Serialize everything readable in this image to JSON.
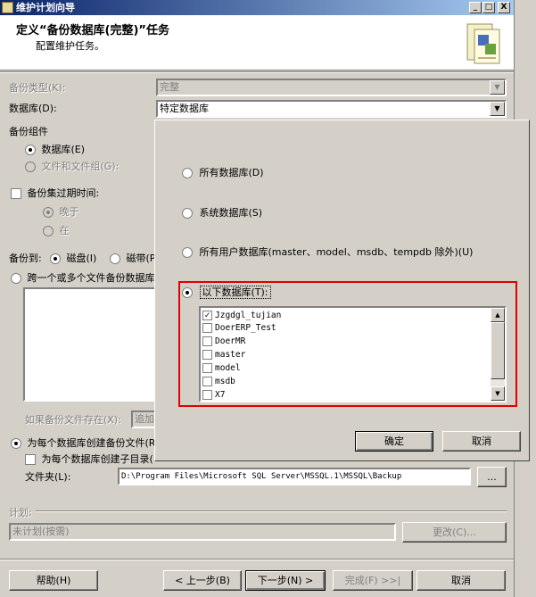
{
  "window": {
    "title": "维护计划向导",
    "buttons": [
      "_",
      "□",
      "X"
    ]
  },
  "header": {
    "title": "定义“备份数据库(完整)”任务",
    "subtitle": "配置维护任务。",
    "graphic_icon": "wizard-graphic-icon"
  },
  "form": {
    "backup_type": {
      "label": "备份类型(K):",
      "value": "完整"
    },
    "database": {
      "label": "数据库(D):",
      "value": "特定数据库"
    },
    "backup_component": {
      "label": "备份组件",
      "database_label": "数据库(E)",
      "files_label": "文件和文件组(G):"
    },
    "expire": {
      "label": "备份集过期时间:",
      "after_label": "晚于",
      "on_label": "在"
    },
    "backup_to": {
      "label": "备份到:",
      "disk_label": "磁盘(I)",
      "tape_label": "磁带(P"
    },
    "span_label": "跨一个或多个文件备份数据库",
    "if_exists": {
      "label": "如果备份文件存在(X):",
      "value": "追加"
    },
    "per_db_file_label": "为每个数据库创建备份文件(R",
    "subdir_label": "为每个数据库创建子目录(",
    "folder": {
      "label": "文件夹(L):",
      "value": "D:\\Program Files\\Microsoft SQL Server\\MSSQL.1\\MSSQL\\Backup",
      "browse": "..."
    },
    "schedule": {
      "label": "计划:",
      "value": "未计划(按需)",
      "change_button": "更改(C)..."
    }
  },
  "popup": {
    "options": [
      "所有数据库(D)",
      "系统数据库(S)",
      "所有用户数据库(master、model、msdb、tempdb 除外)(U)",
      "以下数据库(T):"
    ],
    "databases": [
      {
        "name": "Jzgdgl_tujian",
        "checked": true
      },
      {
        "name": "DoerERP_Test",
        "checked": false
      },
      {
        "name": "DoerMR",
        "checked": false
      },
      {
        "name": "master",
        "checked": false
      },
      {
        "name": "model",
        "checked": false
      },
      {
        "name": "msdb",
        "checked": false
      },
      {
        "name": "X7",
        "checked": false
      }
    ],
    "ok_button": "确定",
    "cancel_button": "取消",
    "highlight_color": "#e00000"
  },
  "footer": {
    "help": "帮助(H)",
    "back": "< 上一步(B)",
    "next": "下一步(N) >",
    "finish": "完成(F) >>|",
    "cancel": "取消"
  }
}
